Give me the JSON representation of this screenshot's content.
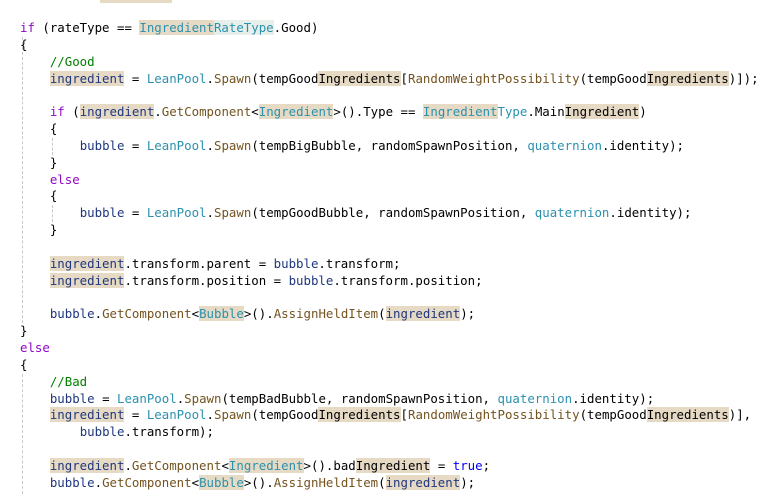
{
  "editor": {
    "colors": {
      "keyword": "#8f08c4",
      "type": "#2b91af",
      "method": "#74531f",
      "variable": "#1f377f",
      "comment": "#008000",
      "literal": "#0000ff",
      "highlight": "#e6dac4"
    },
    "lines": [
      [
        [
          "kw",
          "if"
        ],
        [
          "pl",
          " (rateType == "
        ],
        [
          "ty",
          "Ingredient",
          1
        ],
        [
          "ty",
          "RateType",
          2
        ],
        [
          "pl",
          ".Good)"
        ]
      ],
      [
        [
          "pl",
          "{"
        ]
      ],
      [
        [
          "pl",
          "    "
        ],
        [
          "cm",
          "//Good"
        ]
      ],
      [
        [
          "pl",
          "    "
        ],
        [
          "va",
          "ingredient",
          1
        ],
        [
          "pl",
          " = "
        ],
        [
          "ty",
          "LeanPool"
        ],
        [
          "pl",
          "."
        ],
        [
          "me",
          "Spawn"
        ],
        [
          "pl",
          "(tempGood"
        ],
        [
          "pl",
          "Ingredients",
          1
        ],
        [
          "pl",
          "["
        ],
        [
          "me",
          "RandomWeightPossibility"
        ],
        [
          "pl",
          "(tempGood"
        ],
        [
          "pl",
          "Ingredients",
          1
        ],
        [
          "pl",
          ")]);"
        ]
      ],
      [],
      [
        [
          "pl",
          "    "
        ],
        [
          "kw",
          "if"
        ],
        [
          "pl",
          " ("
        ],
        [
          "va",
          "ingredient",
          1
        ],
        [
          "pl",
          "."
        ],
        [
          "me",
          "GetComponent"
        ],
        [
          "pl",
          "<"
        ],
        [
          "ty",
          "Ingredient",
          1
        ],
        [
          "pl",
          ">().Type == "
        ],
        [
          "ty",
          "Ingredient",
          1
        ],
        [
          "ty",
          "Type"
        ],
        [
          "pl",
          ".Main"
        ],
        [
          "pl",
          "Ingredient",
          1
        ],
        [
          "pl",
          ")"
        ]
      ],
      [
        [
          "pl",
          "    {"
        ]
      ],
      [
        [
          "pl",
          "        "
        ],
        [
          "va",
          "bubble"
        ],
        [
          "pl",
          " = "
        ],
        [
          "ty",
          "LeanPool"
        ],
        [
          "pl",
          "."
        ],
        [
          "me",
          "Spawn"
        ],
        [
          "pl",
          "(tempBigBubble, randomSpawnPosition, "
        ],
        [
          "ty",
          "quaternion"
        ],
        [
          "pl",
          ".identity);"
        ]
      ],
      [
        [
          "pl",
          "    }"
        ]
      ],
      [
        [
          "pl",
          "    "
        ],
        [
          "kw",
          "else"
        ]
      ],
      [
        [
          "pl",
          "    {"
        ]
      ],
      [
        [
          "pl",
          "        "
        ],
        [
          "va",
          "bubble"
        ],
        [
          "pl",
          " = "
        ],
        [
          "ty",
          "LeanPool"
        ],
        [
          "pl",
          "."
        ],
        [
          "me",
          "Spawn"
        ],
        [
          "pl",
          "(tempGoodBubble, randomSpawnPosition, "
        ],
        [
          "ty",
          "quaternion"
        ],
        [
          "pl",
          ".identity);"
        ]
      ],
      [
        [
          "pl",
          "    }"
        ]
      ],
      [],
      [
        [
          "pl",
          "    "
        ],
        [
          "va",
          "ingredient",
          1
        ],
        [
          "pl",
          ".transform.parent = "
        ],
        [
          "va",
          "bubble"
        ],
        [
          "pl",
          ".transform;"
        ]
      ],
      [
        [
          "pl",
          "    "
        ],
        [
          "va",
          "ingredient",
          1
        ],
        [
          "pl",
          ".transform.position = "
        ],
        [
          "va",
          "bubble"
        ],
        [
          "pl",
          ".transform.position;"
        ]
      ],
      [],
      [
        [
          "pl",
          "    "
        ],
        [
          "va",
          "bubble"
        ],
        [
          "pl",
          "."
        ],
        [
          "me",
          "GetComponent"
        ],
        [
          "pl",
          "<"
        ],
        [
          "ty",
          "Bubble",
          1
        ],
        [
          "pl",
          ">()."
        ],
        [
          "me",
          "AssignHeldItem"
        ],
        [
          "pl",
          "("
        ],
        [
          "va",
          "ingredient",
          1
        ],
        [
          "pl",
          ");"
        ]
      ],
      [
        [
          "pl",
          "}"
        ]
      ],
      [
        [
          "kw",
          "else"
        ]
      ],
      [
        [
          "pl",
          "{"
        ]
      ],
      [
        [
          "pl",
          "    "
        ],
        [
          "cm",
          "//Bad"
        ]
      ],
      [
        [
          "pl",
          "    "
        ],
        [
          "va",
          "bubble"
        ],
        [
          "pl",
          " = "
        ],
        [
          "ty",
          "LeanPool"
        ],
        [
          "pl",
          "."
        ],
        [
          "me",
          "Spawn"
        ],
        [
          "pl",
          "(tempBadBubble, randomSpawnPosition, "
        ],
        [
          "ty",
          "quaternion"
        ],
        [
          "pl",
          ".identity);"
        ]
      ],
      [
        [
          "pl",
          "    "
        ],
        [
          "va",
          "ingredient",
          1
        ],
        [
          "pl",
          " = "
        ],
        [
          "ty",
          "LeanPool"
        ],
        [
          "pl",
          "."
        ],
        [
          "me",
          "Spawn"
        ],
        [
          "pl",
          "(tempGood"
        ],
        [
          "pl",
          "Ingredients",
          1
        ],
        [
          "pl",
          "["
        ],
        [
          "me",
          "RandomWeightPossibility"
        ],
        [
          "pl",
          "(tempGood"
        ],
        [
          "pl",
          "Ingredients",
          1
        ],
        [
          "pl",
          ")],"
        ]
      ],
      [
        [
          "pl",
          "        "
        ],
        [
          "va",
          "bubble"
        ],
        [
          "pl",
          ".transform);"
        ]
      ],
      [],
      [
        [
          "pl",
          "    "
        ],
        [
          "va",
          "ingredient",
          1
        ],
        [
          "pl",
          "."
        ],
        [
          "me",
          "GetComponent"
        ],
        [
          "pl",
          "<"
        ],
        [
          "ty",
          "Ingredient",
          1
        ],
        [
          "pl",
          ">().bad"
        ],
        [
          "pl",
          "Ingredient",
          1
        ],
        [
          "pl",
          " = "
        ],
        [
          "bl",
          "true"
        ],
        [
          "pl",
          ";"
        ]
      ],
      [
        [
          "pl",
          "    "
        ],
        [
          "va",
          "bubble"
        ],
        [
          "pl",
          "."
        ],
        [
          "me",
          "GetComponent"
        ],
        [
          "pl",
          "<"
        ],
        [
          "ty",
          "Bubble",
          1
        ],
        [
          "pl",
          ">()."
        ],
        [
          "me",
          "AssignHeldItem"
        ],
        [
          "pl",
          "("
        ],
        [
          "va",
          "ingredient",
          1
        ],
        [
          "pl",
          ");"
        ]
      ]
    ]
  }
}
